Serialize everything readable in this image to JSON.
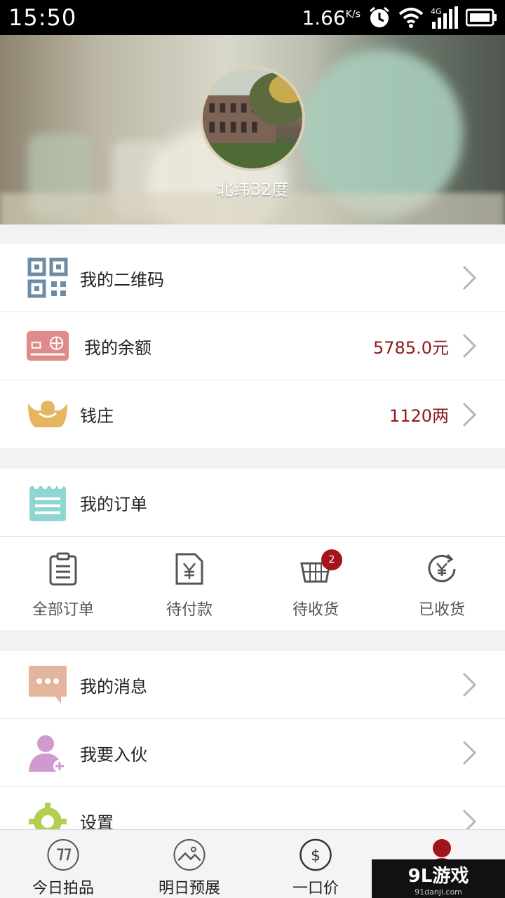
{
  "status_bar": {
    "time": "15:50",
    "speed": "1.66",
    "speed_unit": "K/s",
    "network": "4G"
  },
  "profile": {
    "username": "北纬32度"
  },
  "menu_top": [
    {
      "label": "我的二维码",
      "value": ""
    },
    {
      "label": "我的余额",
      "value": "5785.0元"
    },
    {
      "label": "钱庄",
      "value": "1120两"
    }
  ],
  "orders": {
    "title": "我的订单",
    "items": [
      {
        "label": "全部订单",
        "badge": ""
      },
      {
        "label": "待付款",
        "badge": ""
      },
      {
        "label": "待收货",
        "badge": "2"
      },
      {
        "label": "已收货",
        "badge": ""
      }
    ]
  },
  "menu_bottom": [
    {
      "label": "我的消息"
    },
    {
      "label": "我要入伙"
    },
    {
      "label": "设置"
    }
  ],
  "tabbar": {
    "items": [
      {
        "label": "今日拍品"
      },
      {
        "label": "明日预展"
      },
      {
        "label": "一口价"
      },
      {
        "label": ""
      }
    ]
  },
  "watermark": {
    "logo": "9L游戏",
    "site": "91danji.com"
  },
  "colors": {
    "accent_red": "#8b1a1a",
    "badge_red": "#a4141b",
    "background": "#f0f2f4"
  }
}
